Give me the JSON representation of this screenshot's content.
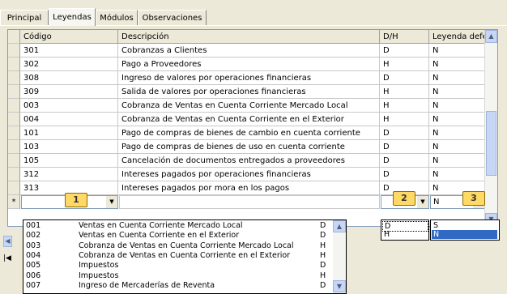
{
  "tabs": [
    "Principal",
    "Leyendas",
    "Módulos",
    "Observaciones"
  ],
  "grid": {
    "columns": [
      "Código",
      "Descripción",
      "D/H",
      "Leyenda defecto"
    ],
    "rows": [
      [
        "301",
        "Cobranzas a Clientes",
        "D",
        "N"
      ],
      [
        "302",
        "Pago a Proveedores",
        "H",
        "N"
      ],
      [
        "308",
        "Ingreso de valores por operaciones financieras",
        "D",
        "N"
      ],
      [
        "309",
        "Salida de valores por operaciones financieras",
        "H",
        "N"
      ],
      [
        "003",
        "Cobranza de Ventas en Cuenta Corriente Mercado Local",
        "H",
        "N"
      ],
      [
        "004",
        "Cobranza de Ventas en Cuenta Corriente en el Exterior",
        "H",
        "N"
      ],
      [
        "101",
        "Pago de compras de bienes de cambio en cuenta corriente",
        "D",
        "N"
      ],
      [
        "103",
        "Pago de compras de bienes de uso en cuenta corriente",
        "D",
        "N"
      ],
      [
        "105",
        "Cancelación de documentos entregados a proveedores",
        "D",
        "N"
      ],
      [
        "312",
        "Intereses pagados por operaciones financieras",
        "D",
        "N"
      ],
      [
        "313",
        "Intereses pagados por mora en los pagos",
        "D",
        "N"
      ]
    ],
    "new_row": {
      "indicator": "*",
      "legend_value": "N"
    }
  },
  "callouts": [
    "1",
    "2",
    "3"
  ],
  "code_dropdown": [
    [
      "001",
      "Ventas en Cuenta Corriente Mercado Local",
      "D"
    ],
    [
      "002",
      "Ventas en Cuenta Corriente en el Exterior",
      "D"
    ],
    [
      "003",
      "Cobranza de Ventas en Cuenta Corriente Mercado Local",
      "H"
    ],
    [
      "004",
      "Cobranza de Ventas en Cuenta Corriente en el Exterior",
      "H"
    ],
    [
      "005",
      "Impuestos",
      "D"
    ],
    [
      "006",
      "Impuestos",
      "H"
    ],
    [
      "007",
      "Ingreso de Mercaderías de Reventa",
      "D"
    ]
  ],
  "dh_dropdown": [
    "D",
    "H"
  ],
  "legend_dropdown": {
    "options": [
      "S",
      "N"
    ],
    "selected": "N"
  }
}
